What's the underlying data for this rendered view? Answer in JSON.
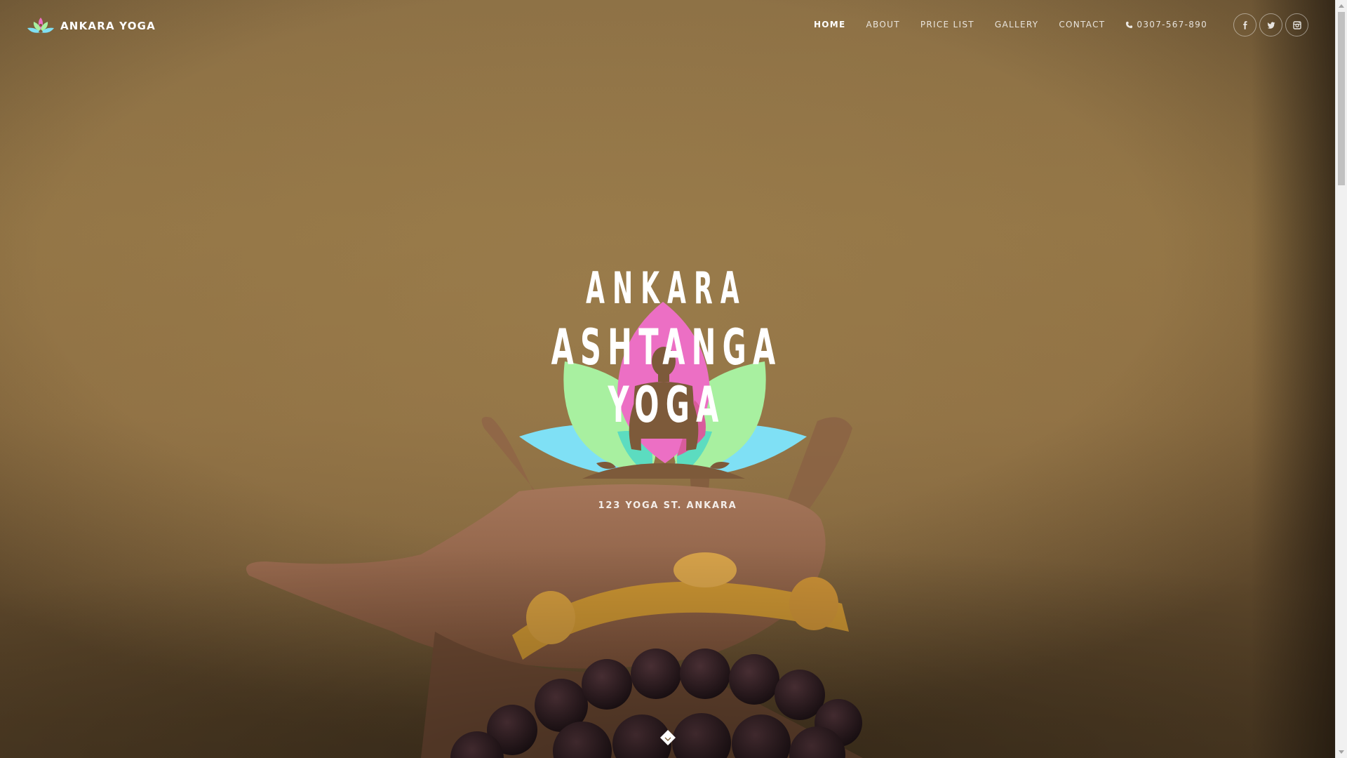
{
  "brand": {
    "name": "ANKARA YOGA",
    "logo_icon": "lotus-icon"
  },
  "nav": {
    "items": [
      {
        "label": "HOME",
        "active": true
      },
      {
        "label": "ABOUT",
        "active": false
      },
      {
        "label": "PRICE LIST",
        "active": false
      },
      {
        "label": "GALLERY",
        "active": false
      },
      {
        "label": "CONTACT",
        "active": false
      }
    ],
    "phone": {
      "icon": "phone-icon",
      "label": "0307-567-890"
    }
  },
  "socials": [
    {
      "icon": "facebook-icon"
    },
    {
      "icon": "twitter-icon"
    },
    {
      "icon": "instagram-icon"
    }
  ],
  "hero": {
    "logo_line_1": "ANKARA",
    "logo_line_2": "ASHTANGA YOGA",
    "address": "123 YOGA ST. ANKARA",
    "scroll_icon": "chevron-down-icon"
  },
  "colors": {
    "lotus_pink": "#ec6fc4",
    "lotus_green": "#a8f0a0",
    "lotus_cyan": "#7fe0f5",
    "silhouette": "#7d5a3a",
    "text": "#ffffff"
  }
}
